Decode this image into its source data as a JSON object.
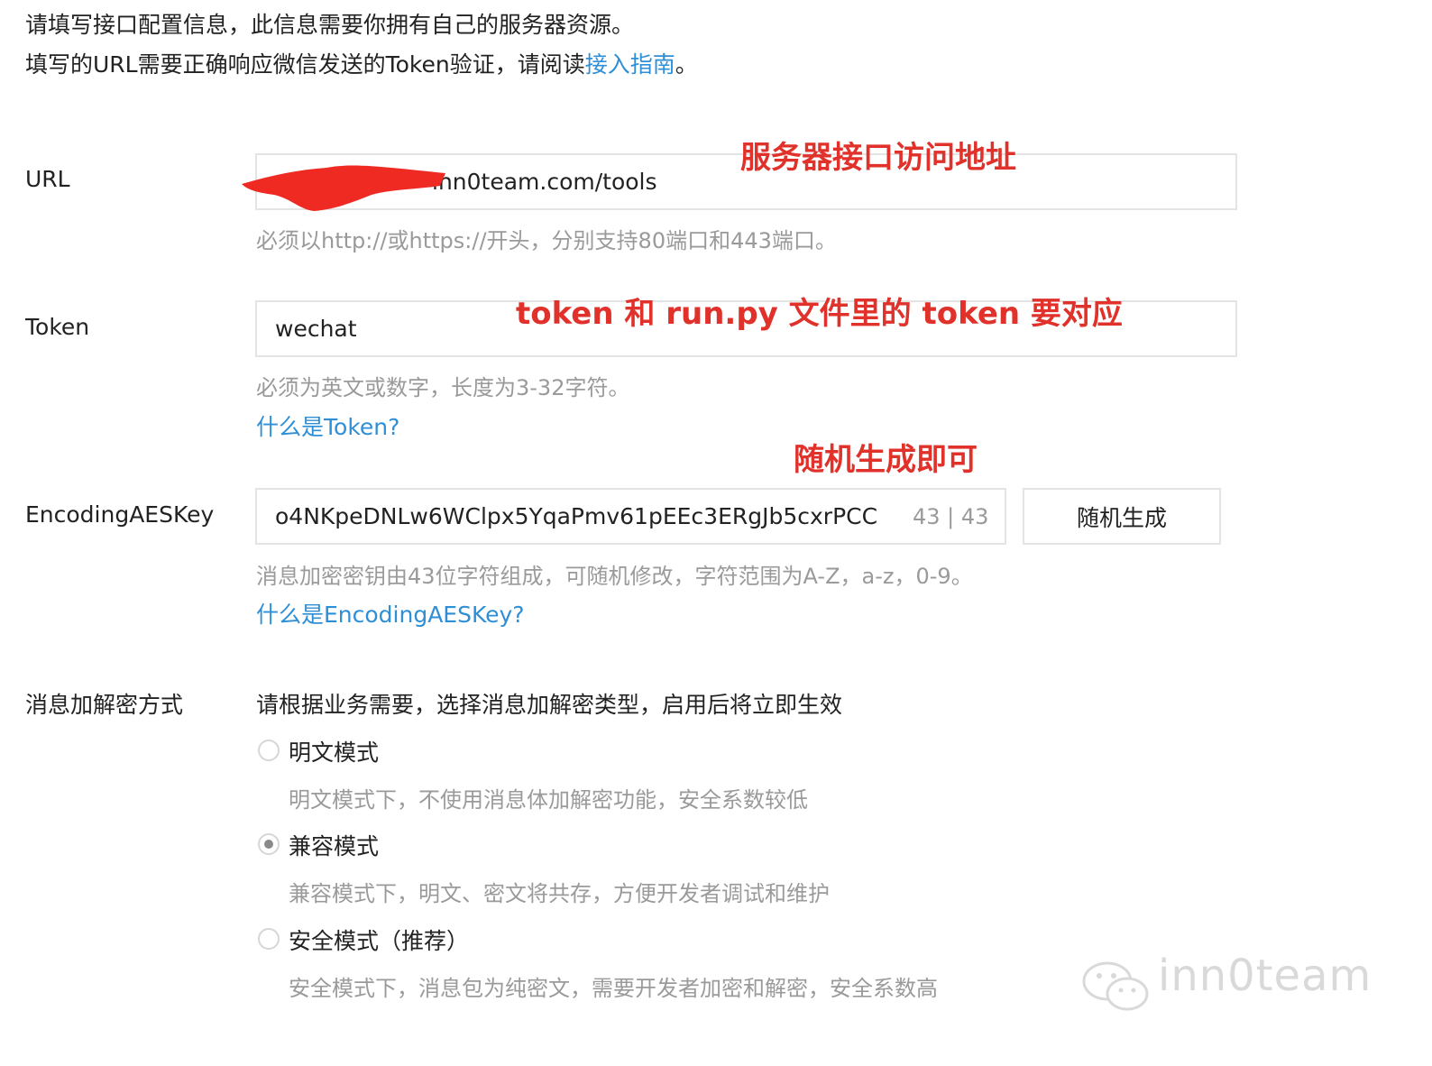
{
  "intro": {
    "line1": "请填写接口配置信息，此信息需要你拥有自己的服务器资源。",
    "line2_prefix": "填写的URL需要正确响应微信发送的Token验证，请阅读",
    "line2_link": "接入指南",
    "line2_suffix": "。"
  },
  "url": {
    "label": "URL",
    "value": "inn0team.com/tools",
    "hint": "必须以http://或https://开头，分别支持80端口和443端口。",
    "annotation": "服务器接口访问地址"
  },
  "token": {
    "label": "Token",
    "value": "wechat",
    "hint": "必须为英文或数字，长度为3-32字符。",
    "help_link": "什么是Token?",
    "annotation": "token 和 run.py 文件里的 token 要对应"
  },
  "aeskey": {
    "label": "EncodingAESKey",
    "value": "o4NKpeDNLw6WClpx5YqaPmv61pEEc3ERgJb5cxrPCC",
    "counter": "43 | 43",
    "generate_button": "随机生成",
    "hint": "消息加密密钥由43位字符组成，可随机修改，字符范围为A-Z，a-z，0-9。",
    "help_link": "什么是EncodingAESKey?",
    "annotation": "随机生成即可"
  },
  "encryption": {
    "label": "消息加解密方式",
    "description": "请根据业务需要，选择消息加解密类型，启用后将立即生效",
    "modes": [
      {
        "label": "明文模式",
        "desc": "明文模式下，不使用消息体加解密功能，安全系数较低",
        "checked": false
      },
      {
        "label": "兼容模式",
        "desc": "兼容模式下，明文、密文将共存，方便开发者调试和维护",
        "checked": true
      },
      {
        "label": "安全模式（推荐）",
        "desc": "安全模式下，消息包为纯密文，需要开发者加密和解密，安全系数高",
        "checked": false
      }
    ]
  },
  "watermark": "inn0team",
  "colors": {
    "link": "#2f8fd6",
    "annotation": "#e0312b",
    "hint": "#9a9a9a",
    "border": "#e4e4e4"
  }
}
